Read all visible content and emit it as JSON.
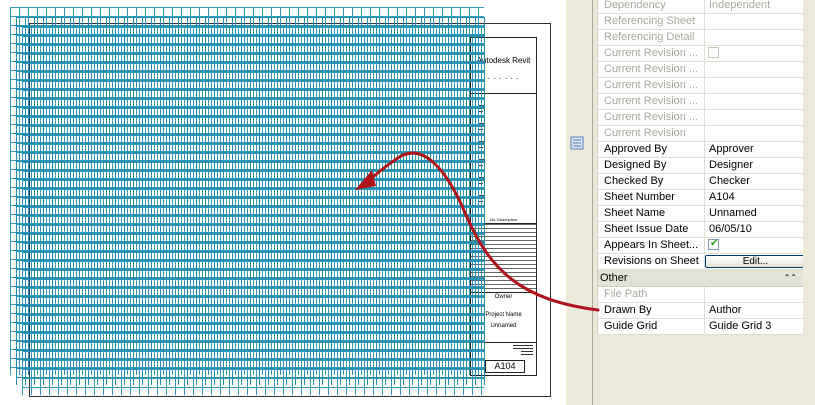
{
  "titleblock": {
    "company": "Autodesk Revit",
    "company_sub": "- - - - - -",
    "revision_header": "No.   Description",
    "owner": "Owner",
    "project_name": "Project Name",
    "sheet_name": "Unnamed",
    "sheet_number": "A104"
  },
  "properties": {
    "top_rows": [
      {
        "label": "Dependency",
        "value": "Independent",
        "enabled": false
      },
      {
        "label": "Referencing Sheet",
        "value": "",
        "enabled": false
      },
      {
        "label": "Referencing Detail",
        "value": "",
        "enabled": false
      },
      {
        "label": "Current Revision ...",
        "value": "",
        "enabled": false,
        "checkbox": true
      },
      {
        "label": "Current Revision ...",
        "value": "",
        "enabled": false
      },
      {
        "label": "Current Revision ...",
        "value": "",
        "enabled": false
      },
      {
        "label": "Current Revision ...",
        "value": "",
        "enabled": false
      },
      {
        "label": "Current Revision ...",
        "value": "",
        "enabled": false
      },
      {
        "label": "Current Revision",
        "value": "",
        "enabled": false
      },
      {
        "label": "Approved By",
        "value": "Approver",
        "enabled": true
      },
      {
        "label": "Designed By",
        "value": "Designer",
        "enabled": true
      },
      {
        "label": "Checked By",
        "value": "Checker",
        "enabled": true
      },
      {
        "label": "Sheet Number",
        "value": "A104",
        "enabled": true
      },
      {
        "label": "Sheet Name",
        "value": "Unnamed",
        "enabled": true
      },
      {
        "label": "Sheet Issue Date",
        "value": "06/05/10",
        "enabled": true
      },
      {
        "label": "Appears In Sheet...",
        "value": "",
        "enabled": true,
        "checkbox": true,
        "checked": true
      },
      {
        "label": "Revisions on Sheet",
        "value": "Edit...",
        "enabled": true,
        "button": true
      }
    ],
    "group_other": "Other",
    "other_rows": [
      {
        "label": "File Path",
        "value": "",
        "enabled": false
      },
      {
        "label": "Drawn By",
        "value": "Author",
        "enabled": true
      },
      {
        "label": "Guide Grid",
        "value": "Guide Grid 3",
        "enabled": true
      }
    ]
  },
  "colors": {
    "grid": "#1f8fb0",
    "arrow": "#b0121b",
    "panel_bg": "#ece9d8",
    "disabled_text": "#a9a89e"
  },
  "icons": {
    "divider_icon": "properties-document-icon",
    "group_collapse": "double-chevron-up-icon"
  }
}
